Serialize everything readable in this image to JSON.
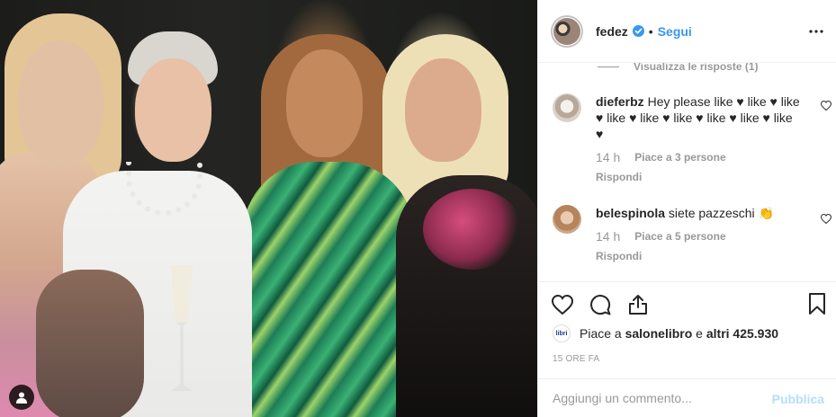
{
  "post": {
    "username": "fedez",
    "follow_label": "Segui",
    "separator": "•",
    "icons": {
      "verified": "verified-badge-icon",
      "more": "more-options-icon",
      "tag": "user-tag-icon",
      "like": "heart-icon",
      "comment": "comment-icon",
      "share": "share-icon",
      "save": "bookmark-icon"
    },
    "colors": {
      "accent": "#3897f0",
      "verified": "#3897f0",
      "publish_disabled": "#b2dffc",
      "muted": "#999999"
    }
  },
  "comments": {
    "view_replies": "Visualizza le risposte (1)",
    "items": [
      {
        "username": "dieferbz",
        "text": "Hey please like ♥ like ♥ like ♥ like ♥ like ♥ like ♥ like ♥ like ♥ like ♥",
        "time": "14 h",
        "likes": "Piace a 3 persone",
        "reply": "Rispondi"
      },
      {
        "username": "belespinola",
        "text": "siete pazzeschi 👏",
        "time": "14 h",
        "likes": "Piace a 5 persone",
        "reply": "Rispondi"
      }
    ]
  },
  "likes": {
    "avatar_text": "libri",
    "prefix": "Piace a",
    "user": "salonelibro",
    "middle": "e",
    "others": "altri 425.930"
  },
  "timestamp": "15 ORE FA",
  "composer": {
    "placeholder": "Aggiungi un commento...",
    "publish_label": "Pubblica"
  }
}
